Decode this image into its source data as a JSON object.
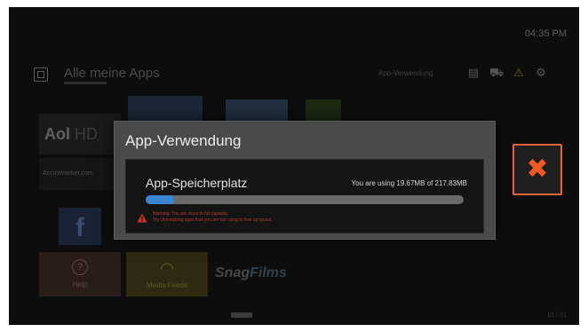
{
  "clock": "04:35 PM",
  "header": {
    "title": "Alle meine Apps",
    "app_usage_link": "App-Verwendung"
  },
  "tiles": {
    "aol_prefix": "Aol",
    "aol_suffix": " HD",
    "weather": "AccuWeather.com",
    "help": "Help",
    "news": "Media Feeds",
    "snag_prefix": "Snag",
    "snag_suffix": "Films"
  },
  "pager": {
    "page_count": "01 / 01"
  },
  "modal": {
    "title": "App-Verwendung",
    "storage_label": "App-Speicherplatz",
    "usage_text": "You are using 19.67MB of 217.83MB",
    "usage_fraction": 0.09,
    "warning_line1": "Warning: You are close to full capacity.",
    "warning_line2": "Try Uninstalling apps that you are not using to free up space."
  },
  "colors": {
    "accent_orange": "#e8633a",
    "progress_blue": "#3a86d2",
    "warning_red": "#b33a34"
  },
  "icons": {
    "close": "close-x-icon",
    "warning": "warning-triangle-icon"
  }
}
